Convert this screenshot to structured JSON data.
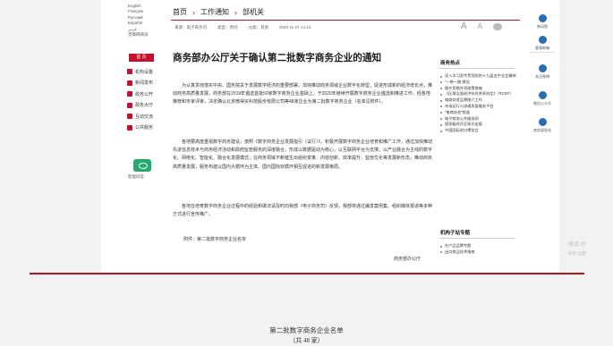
{
  "languages": [
    "English",
    "Français",
    "Русский",
    "Español",
    "عربي",
    "无障碍阅读"
  ],
  "home_label": "首 页",
  "left_nav": [
    "机构设置",
    "新闻发布",
    "政务公开",
    "政务大厅",
    "互动交流",
    "公共服务"
  ],
  "wechat_label": "智能问答",
  "breadcrumb": [
    "首页",
    "工作通知",
    "部机关"
  ],
  "meta": {
    "source": "来源：电子商务司",
    "type": "类型：原创",
    "category": "分类：其他",
    "date": "2020-11-27 14:10"
  },
  "tools": {
    "font_large": "A",
    "font_small": "A"
  },
  "title": "商务部办公厅关于确认第二批数字商务企业的通知",
  "body": {
    "p1": "为认真贯彻落实中央、国务院关于发展数字经济的重要部署，加快推动商务领域企业数字化转型，促进形成新的经济增长点，推动商务高质量发展，商务部在2019年遴选首批60家数字商务企业基础上，于2020年继续开展数字商务企业遴选和推进工作。经各地推荐和专家评审，决定确认北京微得买科技股份有限公司等48家企业为第二批数字商务企业（名单见附件）。",
    "p2": "各地要高度重视数字商务建设，按照《数字商务企业发展指引（试行）》，积极开展数字商务企业培育和推广工作，通过加快推动先进信息技术与商务经济活动和政府监管服务的深度融合，形成以数据驱动为核心，以互联网平台为支撑，以产业融合为主线的数字化、网络化、智能化、融合化发展模式，在商务领域不断催生出组织变革、内容创新、效率提升、监管优化等发展新形态，推动商务高质量发展，服务构建以国内大循环为主体、国内国际双循环相互促进的新发展格局。",
    "p3": "各地在培育数字商务企业过程中的经验和做法请及时向我部（电子商务司）反馈，我部将通过编发案例集、组织媒体报道等多种方式进行宣传推广。",
    "attachment": "附件：第二批数字商务企业名单",
    "signature": "商务部办公厅"
  },
  "hot": {
    "title": "商务热点",
    "items": [
      "深入学习宣传贯彻党的十九届五中全会精神",
      "“一带一路”建设",
      "稳外贸稳外资政策措施",
      "《区域全面经济伙伴关系协定》（RCEP）",
      "电商扶贫品牌推介工作",
      "市场运行与流通发展服务平台",
      "“电商扶贫”频道",
      "电子商务公共服务网",
      "国家级经开区知识出版",
      "中国国际进口博览会"
    ]
  },
  "sub": {
    "title": "机构子站专题",
    "items": [
      "在产品品牌专题",
      "出口商品技术指南"
    ]
  },
  "side": [
    "移动版",
    "客服邮箱",
    "关注微博",
    "微信公众号",
    "商务部驻站"
  ],
  "bottom_doc": {
    "line1": "第二批数字商务企业名单",
    "line2": "（共 48 家）"
  },
  "watermark": {
    "line1": "激活 W",
    "line2": "转到“设置”"
  },
  "colors": {
    "accent": "#c8102e",
    "divider": "#b5161e"
  }
}
